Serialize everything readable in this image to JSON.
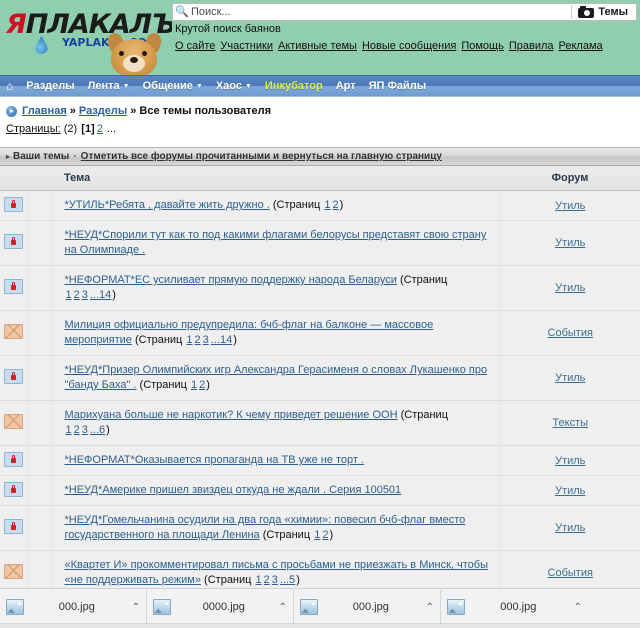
{
  "site": {
    "logo_main": "ЯПЛАКАЛЪ",
    "logo_main_first": "Я",
    "logo_main_rest": "ПЛАКАЛЪ",
    "logo_sub": "YAPLAKAL.COM",
    "slogan": "Крутой поиск баянов"
  },
  "search": {
    "placeholder": "Поиск...",
    "value": "",
    "themes_label": "Темы"
  },
  "toplinks": [
    {
      "label": "О сайте"
    },
    {
      "label": "Участники"
    },
    {
      "label": "Активные темы"
    },
    {
      "label": "Новые сообщения"
    },
    {
      "label": "Помощь"
    },
    {
      "label": "Правила"
    },
    {
      "label": "Реклама"
    }
  ],
  "nav": {
    "home_icon": "home-icon",
    "items": [
      {
        "label": "Разделы",
        "caret": false,
        "active": false
      },
      {
        "label": "Лента",
        "caret": true,
        "active": false
      },
      {
        "label": "Общение",
        "caret": true,
        "active": false
      },
      {
        "label": "Хаос",
        "caret": true,
        "active": false
      },
      {
        "label": "Инкубатор",
        "caret": false,
        "active": true
      },
      {
        "label": "Арт",
        "caret": false,
        "active": false
      },
      {
        "label": "ЯП Файлы",
        "caret": false,
        "active": false
      }
    ],
    "active_color": "#d8f24a"
  },
  "breadcrumb": {
    "home": "Главная",
    "sep1": "»",
    "section": "Разделы",
    "sep2": "»",
    "current": "Все темы пользователя"
  },
  "pages": {
    "label": "Страницы:",
    "total": "(2)",
    "current": "[1]",
    "next": "2",
    "ellipsis": "..."
  },
  "panel": {
    "title": "Ваши темы",
    "dot": "·",
    "mark_read_link": "Отметить все форумы прочитанными и вернуться на главную страницу"
  },
  "table": {
    "headers": {
      "theme": "Тема",
      "forum": "Форум"
    },
    "pages_prefix": "(Страниц ",
    "pages_suffix": ")",
    "rows": [
      {
        "icon": "locked-topic-icon",
        "title": "*УТИЛЬ*Ребята , давайте жить дружно .",
        "pages": [
          "1",
          "2"
        ],
        "pages_ellipsis": "",
        "has_pages": true,
        "forum": "Утиль"
      },
      {
        "icon": "locked-topic-icon",
        "title": "*НЕУД*Спорили тут как то под какими флагами белорусы представят свою страну на Олимпиаде .",
        "pages": [],
        "pages_ellipsis": "",
        "has_pages": false,
        "forum": "Утиль"
      },
      {
        "icon": "locked-topic-icon",
        "title": "*НЕФОРМАТ*ЕС усиливает прямую поддержку народа Беларуси",
        "pages": [
          "1",
          "2",
          "3"
        ],
        "pages_ellipsis": "...14",
        "has_pages": true,
        "forum": "Утиль"
      },
      {
        "icon": "open-topic-icon",
        "title": "Милиция официально предупредила: бчб-флаг на балконе — массовое мероприятие",
        "pages": [
          "1",
          "2",
          "3"
        ],
        "pages_ellipsis": "...14",
        "has_pages": true,
        "forum": "События"
      },
      {
        "icon": "locked-topic-icon",
        "title": "*НЕУД*Призер Олимпийских игр Александра Герасименя о словах Лукашенко про \"банду Баха\" .",
        "pages": [
          "1",
          "2"
        ],
        "pages_ellipsis": "",
        "has_pages": true,
        "forum": "Утиль"
      },
      {
        "icon": "open-topic-icon",
        "title": "Марихуана больше не наркотик? К чему приведет решение ООН",
        "pages": [
          "1",
          "2",
          "3"
        ],
        "pages_ellipsis": "...6",
        "has_pages": true,
        "forum": "Тексты"
      },
      {
        "icon": "locked-topic-icon",
        "title": "*НЕФОРМАТ*Оказывается пропаганда на ТВ уже не торт .",
        "pages": [],
        "pages_ellipsis": "",
        "has_pages": false,
        "forum": "Утиль"
      },
      {
        "icon": "locked-topic-icon",
        "title": "*НЕУД*Америке пришел звиздец откуда не ждали . Серия 100501",
        "pages": [],
        "pages_ellipsis": "",
        "has_pages": false,
        "forum": "Утиль"
      },
      {
        "icon": "locked-topic-icon",
        "title": "*НЕУД*Гомельчанина осудили на два года «химии»: повесил бчб-флаг вместо государственного на площади Ленина",
        "pages": [
          "1",
          "2"
        ],
        "pages_ellipsis": "",
        "has_pages": true,
        "forum": "Утиль"
      },
      {
        "icon": "open-topic-icon",
        "title": "«Квартет И» прокомментировал письма с просьбами не приезжать в Минск, чтобы «не поддерживать режим»",
        "pages": [
          "1",
          "2",
          "3"
        ],
        "pages_ellipsis": "...5",
        "has_pages": true,
        "forum": "События"
      }
    ]
  },
  "taskbar": {
    "downloads": [
      {
        "name": "000.jpg",
        "caret": "⌃"
      },
      {
        "name": "0000.jpg",
        "caret": "⌃"
      },
      {
        "name": "000.jpg",
        "caret": "⌃"
      },
      {
        "name": "000.jpg",
        "caret": "⌃"
      }
    ]
  }
}
